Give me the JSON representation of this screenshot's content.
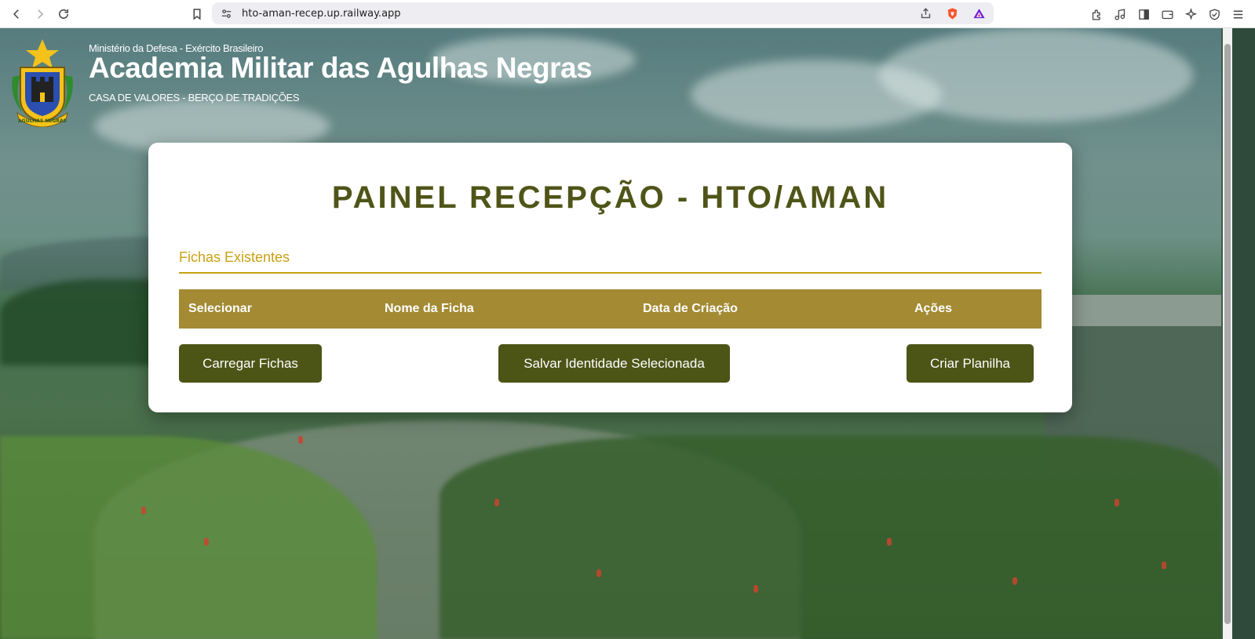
{
  "browser": {
    "url": "hto-aman-recep.up.railway.app"
  },
  "header": {
    "ministry": "Ministério da Defesa - Exército Brasileiro",
    "title": "Academia Militar das Agulhas Negras",
    "subtitle": "CASA DE VALORES - BERÇO DE TRADIÇÕES",
    "emblem_text": "AGULHAS NEGRAS"
  },
  "panel": {
    "title": "PAINEL RECEPÇÃO - HTO/AMAN",
    "section_title": "Fichas Existentes",
    "table_columns": [
      "Selecionar",
      "Nome da Ficha",
      "Data de Criação",
      "Ações"
    ],
    "buttons": {
      "load": "Carregar Fichas",
      "save": "Salvar Identidade Selecionada",
      "create": "Criar Planilha"
    }
  },
  "colors": {
    "title_olive": "#4f5518",
    "section_gold": "#c9a014",
    "table_header": "#a38a33",
    "button_olive": "#4c5516"
  }
}
